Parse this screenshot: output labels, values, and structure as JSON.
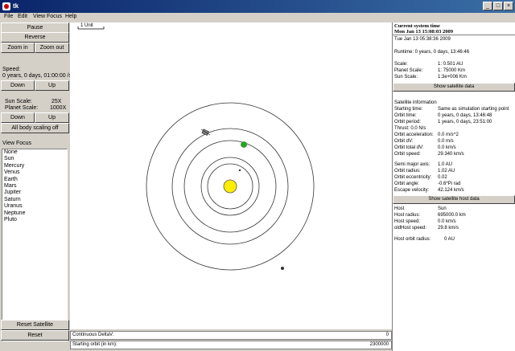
{
  "window": {
    "title": "tk",
    "buttons": [
      "_",
      "□",
      "×"
    ]
  },
  "menu": [
    "File",
    "Edit",
    "View Focus",
    "Help"
  ],
  "left": {
    "pause": "Pause",
    "reverse": "Reverse",
    "zoom_in": "Zoom in",
    "zoom_out": "Zoom out",
    "speed_label": "Speed:",
    "speed_value": "0 years,  0 days, 01:00:00 /s",
    "down": "Down",
    "up": "Up",
    "sun_scale_label": "Sun Scale:",
    "sun_scale_value": "25X",
    "planet_scale_label": "Planet Scale:",
    "planet_scale_value": "1000X",
    "scale_down": "Down",
    "scale_up": "Up",
    "all_body_scaling": "All body scaling off",
    "view_focus_label": "View Focus",
    "view_focus_items": [
      "None",
      "Sun",
      "Mercury",
      "Venus",
      "Earth",
      "Mars",
      "Jupiter",
      "Saturn",
      "Uranus",
      "Neptune",
      "Pluto"
    ],
    "reset_satellite": "Reset Satellite",
    "reset": "Reset"
  },
  "canvas": {
    "scale_label": "1 Unit",
    "sun_color": "#ffee00",
    "planet_color": "#22aa22"
  },
  "bottom": {
    "delta_label": "Continuous DeltaV:",
    "delta_value": "0",
    "orbit_label": "Starting orbit (in km):",
    "orbit_value": "2300000"
  },
  "right": {
    "current_time_label": "Current system time",
    "current_time_value": "Mon Jan 13 15:08:03 2009",
    "start_time": "Tue Jan 13 05:38:36 2009",
    "runtime": "Runtime: 0 years,  0 days, 13:46:46",
    "scale_rows": [
      {
        "label": "Scale:",
        "value": "1: 0.501 AU"
      },
      {
        "label": "Planet Scale:",
        "value": "1: 75000 Km"
      },
      {
        "label": "Sun Scale:",
        "value": "1:3e+006 Km"
      }
    ],
    "show_satellite_data": "Show satellite data",
    "satellite_info_label": "Satellite information",
    "satellite_rows": [
      {
        "label": "Starting time:",
        "value": "Same as simulation starting point"
      },
      {
        "label": "Orbit time:",
        "value": "0 years,  0 days, 13:46:48"
      },
      {
        "label": "Orbit period:",
        "value": "1 years,  0 days, 23:51:00"
      },
      {
        "label": "Thrust:    0.0 N/s",
        "value": ""
      },
      {
        "label": "Orbit acceleration:",
        "value": "0.0 m/s^2"
      },
      {
        "label": "Orbit dV:",
        "value": "0.0 m/s"
      },
      {
        "label": "Orbit total dV:",
        "value": "0.0 km/s"
      },
      {
        "label": "Orbit speed:",
        "value": "29.340 km/s"
      }
    ],
    "orbit_rows": [
      {
        "label": "Semi major axis:",
        "value": "1.0 AU"
      },
      {
        "label": "Orbit radius:",
        "value": "1.02 AU"
      },
      {
        "label": "Orbit eccentricity:",
        "value": "0.02"
      },
      {
        "label": "Orbit angle:",
        "value": "-0.6*Pi rad"
      },
      {
        "label": "Escape velocity:",
        "value": "42.124 km/s"
      }
    ],
    "show_host_data": "Show satellite host data",
    "host_rows": [
      {
        "label": "Host",
        "value": "Sun"
      },
      {
        "label": "Host radius:",
        "value": "695000.0 km"
      },
      {
        "label": "Host speed:",
        "value": "0.0 km/s"
      },
      {
        "label": "oldHost speed:",
        "value": "29.8 km/s"
      }
    ],
    "host_orbit_label": "Host orbit radius:",
    "host_orbit_value": "0 AU"
  }
}
